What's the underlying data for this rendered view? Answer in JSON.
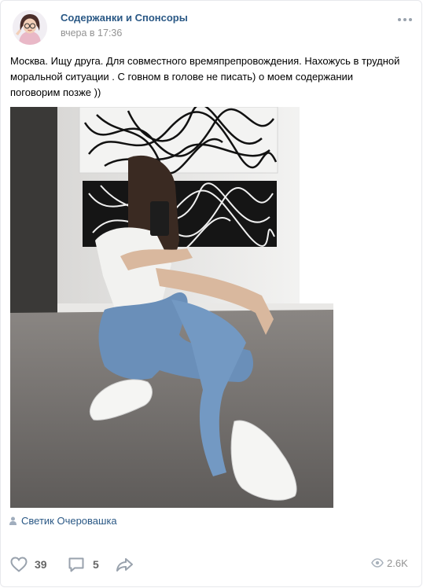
{
  "post": {
    "community_name": "Содержанки и Спонсоры",
    "date": "вчера в 17:36",
    "text_line1": "Москва. Ищу друга. Для совместного времяпрепровождения. Нахожусь в трудной",
    "text_line2": "моральной ситуации . С говном в голове не писать) о моем содержании",
    "text_line3": "поговорим позже ))",
    "signer": "Светик Очеровашка"
  },
  "actions": {
    "likes": "39",
    "comments": "5",
    "views": "2.6K"
  },
  "icons": {
    "more": "more-horizontal-icon",
    "user": "user-icon",
    "like": "heart-icon",
    "comment": "comment-icon",
    "share": "share-arrow-icon",
    "views": "eye-icon"
  },
  "colors": {
    "link": "#2a5885",
    "muted": "#939393",
    "action": "#656565"
  }
}
